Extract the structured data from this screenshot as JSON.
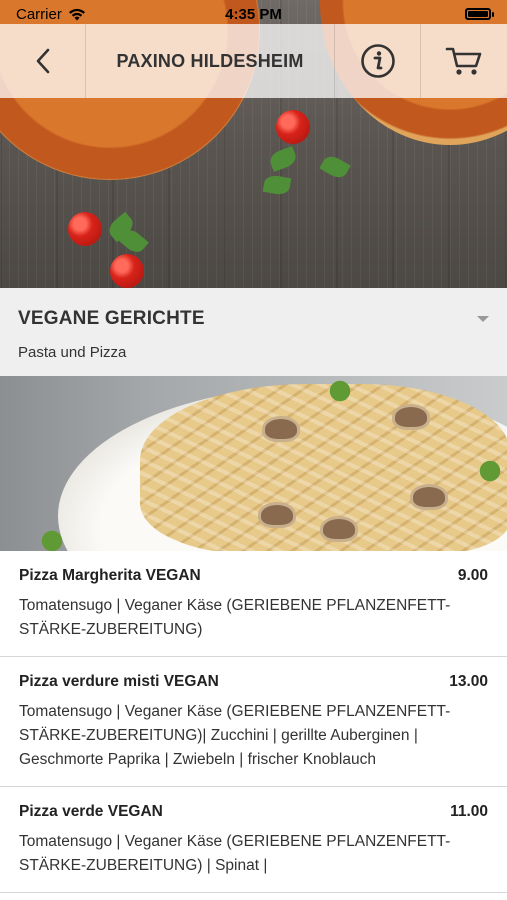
{
  "status_bar": {
    "carrier": "Carrier",
    "time": "4:35 PM"
  },
  "nav": {
    "title": "PAXINO HILDESHEIM",
    "back_icon": "chevron-left-icon",
    "info_icon": "info-icon",
    "cart_icon": "cart-icon"
  },
  "category": {
    "title": "VEGANE GERICHTE",
    "subtitle": "Pasta und Pizza",
    "toggle_icon": "caret-down-icon"
  },
  "menu": {
    "items": [
      {
        "name": "Pizza Margherita VEGAN",
        "price": "9.00",
        "description": "Tomatensugo | Veganer Käse (GERIEBENE PFLANZENFETT-STÄRKE-ZUBEREITUNG)"
      },
      {
        "name": "Pizza verdure misti VEGAN",
        "price": "13.00",
        "description": "Tomatensugo | Veganer Käse (GERIEBENE PFLANZENFETT-STÄRKE-ZUBEREITUNG)| Zucchini | gerillte Auberginen | Geschmorte Paprika | Zwiebeln | frischer Knoblauch"
      },
      {
        "name": "Pizza verde VEGAN",
        "price": "11.00",
        "description": "Tomatensugo | Veganer Käse (GERIEBENE PFLANZENFETT-STÄRKE-ZUBEREITUNG) | Spinat |"
      }
    ]
  },
  "colors": {
    "category_bg": "#efefef",
    "nav_bg": "rgba(255,255,255,0.75)",
    "divider": "#d6d6d6"
  }
}
